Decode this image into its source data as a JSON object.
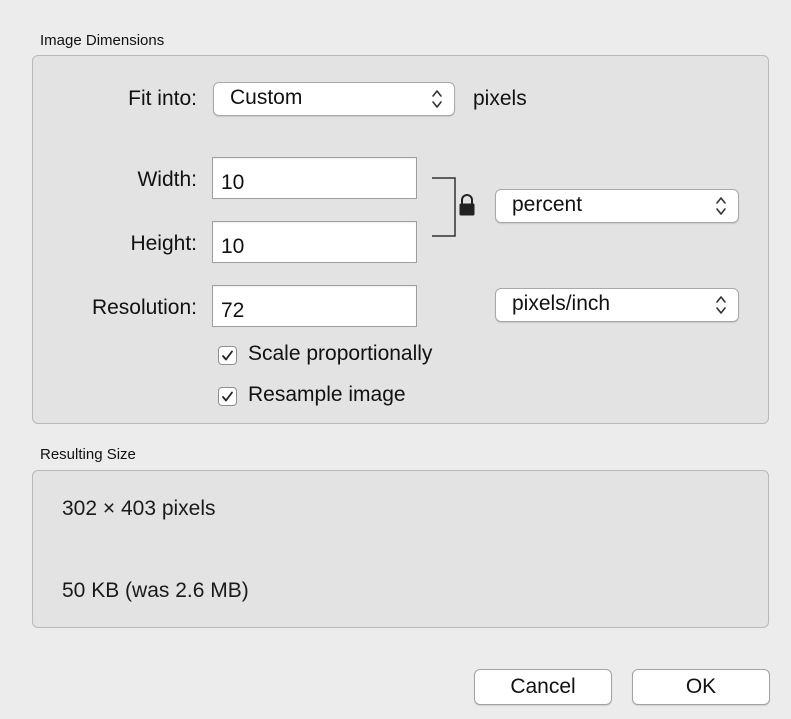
{
  "image_dimensions": {
    "section_title": "Image Dimensions",
    "fit_into": {
      "label": "Fit into:",
      "selected": "Custom",
      "unit": "pixels"
    },
    "width": {
      "label": "Width:",
      "value": "10"
    },
    "height": {
      "label": "Height:",
      "value": "10"
    },
    "size_unit": {
      "selected": "percent"
    },
    "resolution": {
      "label": "Resolution:",
      "value": "72",
      "unit_selected": "pixels/inch"
    },
    "options": [
      {
        "label": "Scale proportionally",
        "checked": true
      },
      {
        "label": "Resample image",
        "checked": true
      }
    ],
    "icons": {
      "lock": "lock-icon",
      "popup_arrows": "chevron-up-down-icon",
      "checkmark": "checkmark-icon"
    }
  },
  "resulting_size": {
    "section_title": "Resulting Size",
    "dimensions": "302 × 403 pixels",
    "file_size": "50 KB (was 2.6 MB)"
  },
  "buttons": {
    "cancel": "Cancel",
    "ok": "OK"
  },
  "colors": {
    "window_background": "#ececec",
    "group_background": "#e3e3e3",
    "group_border": "#b9b9b9",
    "control_background": "#ffffff"
  }
}
